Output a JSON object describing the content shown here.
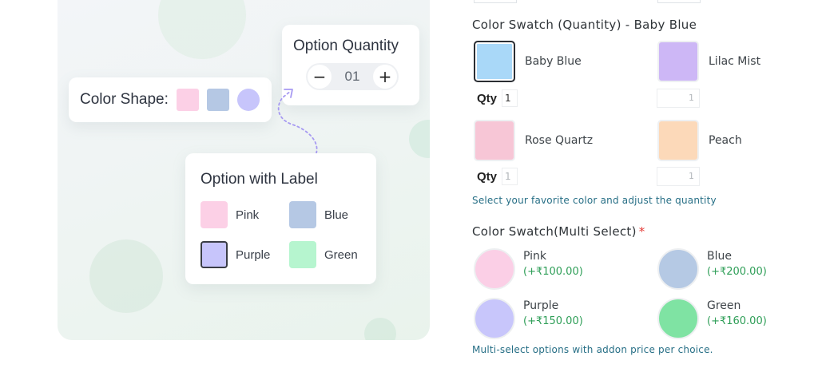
{
  "promo": {
    "shape_card": {
      "label": "Color Shape:",
      "swatches": [
        {
          "shape": "square",
          "color": "#fcd0e6"
        },
        {
          "shape": "square",
          "color": "#b5c8e4"
        },
        {
          "shape": "circle",
          "color": "#c7c5fb"
        }
      ]
    },
    "quantity_card": {
      "title": "Option Quantity",
      "minus": "−",
      "value": "01",
      "plus": "+"
    },
    "label_card": {
      "title": "Option with Label",
      "options": [
        {
          "label": "Pink",
          "color": "#fcd0e6"
        },
        {
          "label": "Blue",
          "color": "#b5c8e4"
        },
        {
          "label": "Purple",
          "color": "#c7c5fb",
          "selected": true
        },
        {
          "label": "Green",
          "color": "#b6f5cf"
        }
      ]
    }
  },
  "form": {
    "qty_section": {
      "title": "Color Swatch (Quantity) - Baby Blue",
      "options": [
        {
          "label": "Baby Blue",
          "color": "#a9d8f8",
          "selected": true,
          "qty": "1"
        },
        {
          "label": "Lilac Mist",
          "color": "#cdb7f6",
          "qty": "1"
        },
        {
          "label": "Rose Quartz",
          "color": "#f7c6d6",
          "qty": "1"
        },
        {
          "label": "Peach",
          "color": "#fcd9b9",
          "qty": "1"
        }
      ],
      "qty_label": "Qty",
      "help": "Select your favorite color and adjust the quantity"
    },
    "multi_section": {
      "title": "Color Swatch(Multi Select)",
      "required_mark": "*",
      "options": [
        {
          "label": "Pink",
          "price": "(+₹100.00)",
          "color": "#fbcfe6"
        },
        {
          "label": "Blue",
          "price": "(+₹200.00)",
          "color": "#b5c9e4"
        },
        {
          "label": "Purple",
          "price": "(+₹150.00)",
          "color": "#c8c6fb"
        },
        {
          "label": "Green",
          "price": "(+₹160.00)",
          "color": "#7fe3a3"
        }
      ],
      "help": "Multi-select options with addon price per choice."
    }
  }
}
